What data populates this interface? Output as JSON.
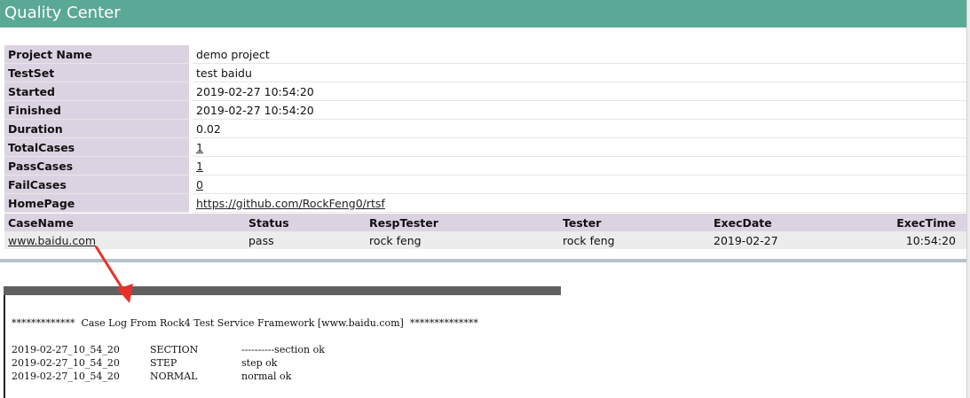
{
  "header": {
    "title": "Quality Center"
  },
  "info": [
    {
      "key": "Project Name",
      "value": "demo project"
    },
    {
      "key": "TestSet",
      "value": "test baidu"
    },
    {
      "key": "Started",
      "value": "2019-02-27 10:54:20"
    },
    {
      "key": "Finished",
      "value": "2019-02-27 10:54:20"
    },
    {
      "key": "Duration",
      "value": "0.02"
    },
    {
      "key": "TotalCases",
      "value": "1"
    },
    {
      "key": "PassCases",
      "value": "1"
    },
    {
      "key": "FailCases",
      "value": "0"
    },
    {
      "key": "HomePage",
      "value": "https://github.com/RockFeng0/rtsf"
    }
  ],
  "cases": {
    "headers": [
      "CaseName",
      "Status",
      "RespTester",
      "Tester",
      "ExecDate",
      "ExecTime"
    ],
    "rows": [
      [
        "www.baidu.com",
        "pass",
        "rock feng",
        "rock feng",
        "2019-02-27",
        "10:54:20"
      ]
    ]
  },
  "log": {
    "title": "*************  Case Log From Rock4 Test Service Framework [www.baidu.com]  **************",
    "entries": [
      {
        "time": "2019-02-27_10_54_20",
        "level": "SECTION",
        "message": "----------section ok"
      },
      {
        "time": "2019-02-27_10_54_20",
        "level": "STEP",
        "message": "step ok"
      },
      {
        "time": "2019-02-27_10_54_20",
        "level": "NORMAL",
        "message": "normal ok"
      }
    ]
  },
  "colors": {
    "header_bg": "#5aa896",
    "key_cell_bg": "#dcd3e2",
    "row_bg": "#ececec",
    "arrow": "#e8302a",
    "log_bar": "#606060"
  }
}
